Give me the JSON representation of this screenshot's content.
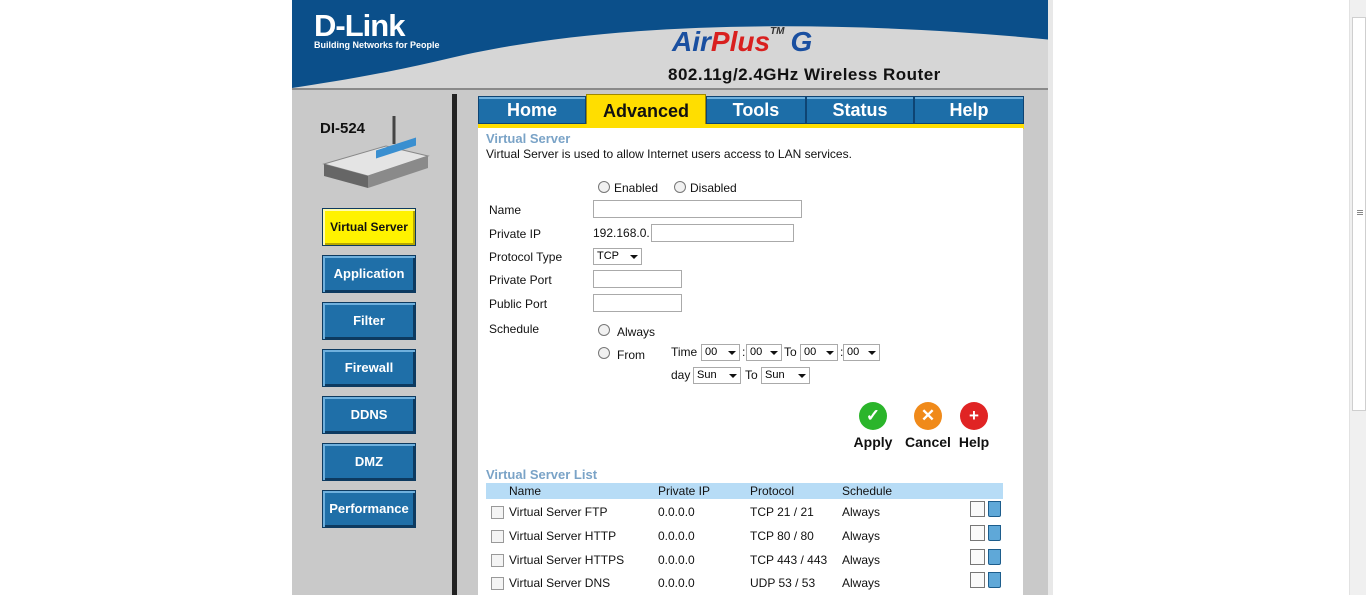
{
  "brand": {
    "logo": "D-Link",
    "tagline": "Building Networks for People",
    "product_part1": "Air",
    "product_part2": "Plus",
    "product_tm": "TM",
    "product_g": "G",
    "subtitle": "802.11g/2.4GHz Wireless Router",
    "model": "DI-524"
  },
  "tabs": [
    {
      "label": "Home"
    },
    {
      "label": "Advanced"
    },
    {
      "label": "Tools"
    },
    {
      "label": "Status"
    },
    {
      "label": "Help"
    }
  ],
  "sidebar": {
    "items": [
      {
        "label": "Virtual Server"
      },
      {
        "label": "Application"
      },
      {
        "label": "Filter"
      },
      {
        "label": "Firewall"
      },
      {
        "label": "DDNS"
      },
      {
        "label": "DMZ"
      },
      {
        "label": "Performance"
      }
    ]
  },
  "section": {
    "title": "Virtual Server",
    "description": "Virtual Server is used to allow Internet users access to LAN services."
  },
  "form": {
    "enabled_label": "Enabled",
    "disabled_label": "Disabled",
    "name_label": "Name",
    "name_value": "",
    "private_ip_label": "Private IP",
    "private_ip_prefix": "192.168.0.",
    "private_ip_value": "",
    "protocol_label": "Protocol Type",
    "protocol_value": "TCP",
    "private_port_label": "Private Port",
    "private_port_value": "",
    "public_port_label": "Public Port",
    "public_port_value": "",
    "schedule_label": "Schedule",
    "always_label": "Always",
    "from_label": "From",
    "time_label": "Time",
    "to_label": "To",
    "day_label": "day",
    "colon": ":",
    "time_from_hour": "00",
    "time_from_min": "00",
    "time_to_hour": "00",
    "time_to_min": "00",
    "day_from": "Sun",
    "day_to": "Sun"
  },
  "actions": {
    "apply": "Apply",
    "cancel": "Cancel",
    "help": "Help"
  },
  "list": {
    "title": "Virtual Server List",
    "headers": [
      "Name",
      "Private IP",
      "Protocol",
      "Schedule"
    ],
    "rows": [
      {
        "name": "Virtual Server FTP",
        "ip": "0.0.0.0",
        "protocol": "TCP 21 / 21",
        "schedule": "Always"
      },
      {
        "name": "Virtual Server HTTP",
        "ip": "0.0.0.0",
        "protocol": "TCP 80 / 80",
        "schedule": "Always"
      },
      {
        "name": "Virtual Server HTTPS",
        "ip": "0.0.0.0",
        "protocol": "TCP 443 / 443",
        "schedule": "Always"
      },
      {
        "name": "Virtual Server DNS",
        "ip": "0.0.0.0",
        "protocol": "UDP 53 / 53",
        "schedule": "Always"
      }
    ]
  },
  "colors": {
    "header_blue": "#0b4f8a",
    "tab_blue": "#1d6ea8",
    "active_yellow": "#ffde00",
    "section_title": "#7aa3c7",
    "list_header_bg": "#b7dcf6"
  }
}
